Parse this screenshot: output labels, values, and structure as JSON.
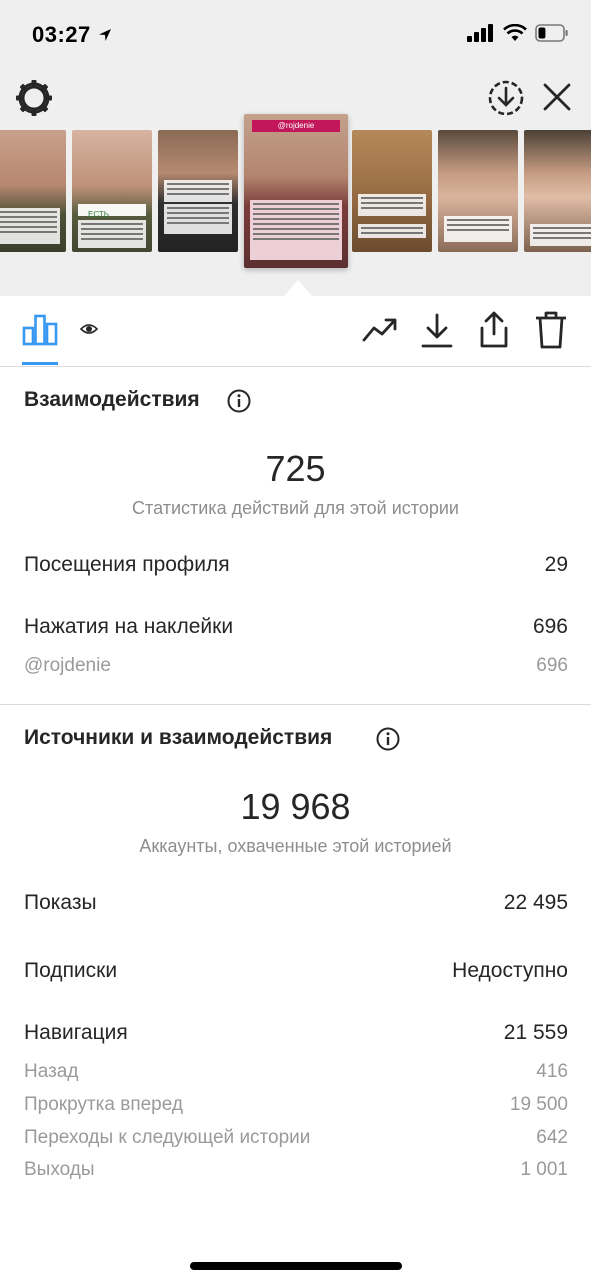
{
  "status_bar": {
    "time": "03:27",
    "battery_level": 0.3
  },
  "story_strip": {
    "thumbnails": [
      {
        "id": "story-1"
      },
      {
        "id": "story-2",
        "tag": "ЕСТЬ"
      },
      {
        "id": "story-3"
      },
      {
        "id": "story-4",
        "tag": "@rojdenie",
        "selected": true
      },
      {
        "id": "story-5"
      },
      {
        "id": "story-6"
      },
      {
        "id": "story-7"
      }
    ]
  },
  "toolbar": {
    "icons": [
      "bar-chart-icon",
      "eye-icon",
      "trend-icon",
      "download-icon",
      "share-icon",
      "trash-icon"
    ],
    "active_tab_color": "#3897f0"
  },
  "interactions": {
    "title": "Взаимодействия",
    "total": "725",
    "caption": "Статистика действий для этой истории",
    "rows": [
      {
        "label": "Посещения профиля",
        "value": "29"
      },
      {
        "label": "Нажатия на наклейки",
        "value": "696"
      }
    ],
    "sub_rows": [
      {
        "label": "@rojdenie",
        "value": "696"
      }
    ]
  },
  "discovery": {
    "title": "Источники и взаимодействия",
    "total": "19 968",
    "caption": "Аккаунты, охваченные этой историей",
    "impressions": {
      "label": "Показы",
      "value": "22 495"
    },
    "follows": {
      "label": "Подписки",
      "value": "Недоступно"
    },
    "navigation": {
      "label": "Навигация",
      "value": "21 559"
    },
    "nav_rows": [
      {
        "label": "Назад",
        "value": "416"
      },
      {
        "label": "Прокрутка вперед",
        "value": "19 500"
      },
      {
        "label": "Переходы к следующей истории",
        "value": "642"
      },
      {
        "label": "Выходы",
        "value": "1 001"
      }
    ]
  }
}
